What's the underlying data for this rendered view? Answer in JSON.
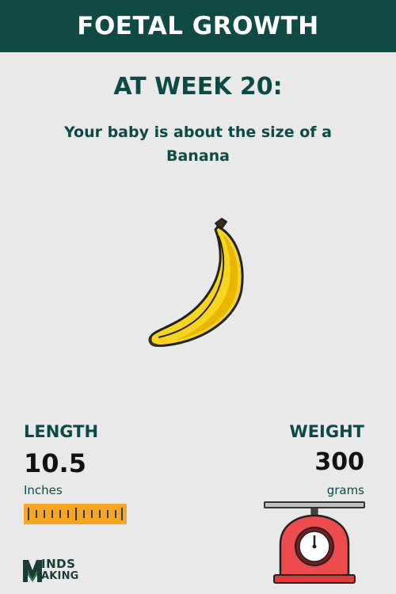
{
  "header": {
    "title": "FOETAL GROWTH"
  },
  "main": {
    "week_heading": "AT WEEK 20:",
    "size_line1": "Your baby is about the size of a",
    "size_line2": "Banana",
    "fruit_icon": "banana-icon"
  },
  "length": {
    "label": "LENGTH",
    "value": "10.5",
    "unit": "Inches",
    "icon": "ruler-icon"
  },
  "weight": {
    "label": "WEIGHT",
    "value": "300",
    "unit": "grams",
    "icon": "scale-icon"
  },
  "logo": {
    "line1": "INDS",
    "line2": "AKING",
    "letter": "M"
  },
  "colors": {
    "header_bg": "#0f4a45",
    "text": "#0e4a45",
    "background": "#e9e9e9",
    "ruler": "#f5a623",
    "scale": "#ef4b4b",
    "banana": "#f5d623"
  }
}
